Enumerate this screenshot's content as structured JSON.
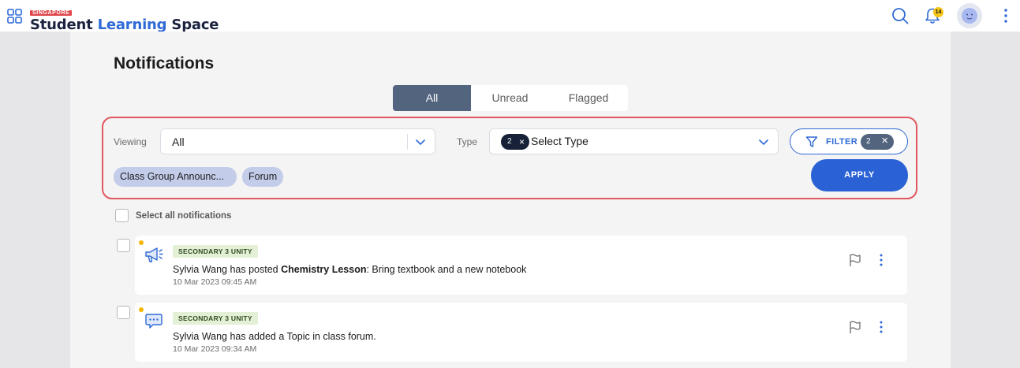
{
  "header": {
    "logo_tag": "SINGAPORE",
    "logo_part1": "Student ",
    "logo_part2": "Learning",
    "logo_part3": " Space",
    "notification_count": "14",
    "icons": [
      "apps-grid-icon",
      "search-icon",
      "bell-icon",
      "avatar",
      "more-vertical-icon"
    ]
  },
  "page": {
    "title": "Notifications"
  },
  "tabs": [
    {
      "label": "All",
      "active": true
    },
    {
      "label": "Unread",
      "active": false
    },
    {
      "label": "Flagged",
      "active": false
    }
  ],
  "filters": {
    "viewing_label": "Viewing",
    "viewing_value": "All",
    "type_label": "Type",
    "type_count": "2",
    "type_placeholder": "Select Type",
    "filter_label": "FILTER",
    "filter_count": "2",
    "chips": [
      "Class Group Announc...",
      "Forum"
    ],
    "apply_label": "APPLY"
  },
  "select_all_label": "Select all notifications",
  "notifications": [
    {
      "badge": "SECONDARY 3 UNITY",
      "msg_pre": "Sylvia Wang has posted ",
      "msg_bold": "Chemistry Lesson",
      "msg_post": ": Bring textbook and a new notebook",
      "time": "10 Mar 2023 09:45 AM",
      "icon": "megaphone-icon",
      "unread": true
    },
    {
      "badge": "SECONDARY 3 UNITY",
      "msg_pre": "Sylvia Wang has added a Topic in class forum.",
      "msg_bold": "",
      "msg_post": "",
      "time": "10 Mar 2023 09:34 AM",
      "icon": "chat-bubbles-icon",
      "unread": true
    }
  ],
  "colors": {
    "accent": "#2a62d6",
    "active_tab": "#52647e",
    "highlight_border": "#e0585f",
    "unread_dot": "#f5b800"
  }
}
